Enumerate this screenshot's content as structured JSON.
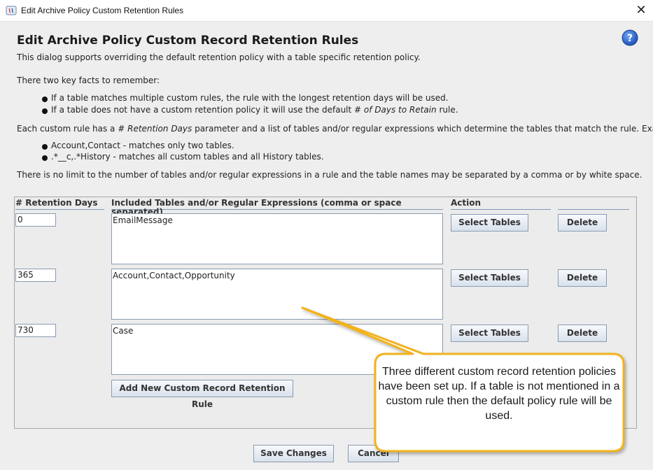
{
  "window": {
    "title": "Edit Archive Policy Custom Retention Rules",
    "close_glyph": "✕",
    "app_icon": "java-app-icon",
    "help_icon": "help-question-icon",
    "help_glyph": "?"
  },
  "heading": "Edit Archive Policy Custom Record Retention Rules",
  "intro": "This dialog supports overriding the default retention policy with a table specific retention policy.",
  "facts_intro": "There two key facts to remember:",
  "facts": [
    {
      "pre": "If a table matches multiple custom rules, the rule with the longest retention days will be used.",
      "em": "",
      "post": ""
    },
    {
      "pre": "If a table does not have a custom retention policy it will use the default ",
      "em": "# of Days to Retain",
      "post": " rule."
    }
  ],
  "custom_rule_intro": {
    "pre": "Each custom rule has a ",
    "em": "# Retention Days",
    "post": " parameter and a list of tables and/or regular expressions which determine the tables that match the rule. Examples:"
  },
  "examples": [
    "Account,Contact - matches only two tables.",
    ".*__c,.*History - matches all custom tables and all History tables."
  ],
  "no_limit": "There is no limit to the number of tables and/or regular expressions in a rule and the table names may be separated by a comma or by white space.",
  "table": {
    "headers": {
      "days": "# Retention Days",
      "tables": "Included Tables and/or Regular Expressions (comma or space separated)",
      "action": "Action"
    },
    "rules": [
      {
        "days": "0",
        "tables": "EmailMessage"
      },
      {
        "days": "365",
        "tables": "Account,Contact,Opportunity"
      },
      {
        "days": "730",
        "tables": "Case"
      }
    ],
    "select_label": "Select Tables",
    "delete_label": "Delete",
    "add_label": "Add New Custom Record Retention Rule"
  },
  "footer": {
    "save_label": "Save Changes",
    "cancel_label": "Cancel"
  },
  "callout": {
    "text": "Three different custom record retention policies have been set up. If a table is not mentioned in a custom rule then the default policy rule will be used.",
    "color": "#f2b21a"
  }
}
